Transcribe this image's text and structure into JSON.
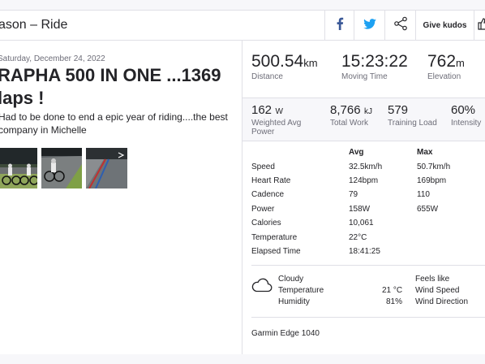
{
  "header": {
    "title": "ason – Ride",
    "kudos_label": "Give kudos"
  },
  "activity": {
    "date": "Saturday, December 24, 2022",
    "title": "RAPHA 500 IN ONE ...1369 laps !",
    "description": "Had to be done to end a epic year of riding....the best company in Michelle"
  },
  "primary_stats": [
    {
      "value": "500.54",
      "unit": "km",
      "label": "Distance"
    },
    {
      "value": "15:23:22",
      "unit": "",
      "label": "Moving Time"
    },
    {
      "value": "762",
      "unit": "m",
      "label": "Elevation"
    }
  ],
  "secondary_stats": [
    {
      "value": "162",
      "unit": "W",
      "label": "Weighted Avg Power"
    },
    {
      "value": "8,766",
      "unit": "kJ",
      "label": "Total Work"
    },
    {
      "value": "579",
      "unit": "",
      "label": "Training Load"
    },
    {
      "value": "60%",
      "unit": "",
      "label": "Intensity"
    }
  ],
  "table": {
    "avg_header": "Avg",
    "max_header": "Max",
    "rows": [
      {
        "label": "Speed",
        "avg": "32.5km/h",
        "max": "50.7km/h"
      },
      {
        "label": "Heart Rate",
        "avg": "124bpm",
        "max": "169bpm"
      },
      {
        "label": "Cadence",
        "avg": "79",
        "max": "110"
      },
      {
        "label": "Power",
        "avg": "158W",
        "max": "655W"
      },
      {
        "label": "Calories",
        "avg": "10,061",
        "max": ""
      },
      {
        "label": "Temperature",
        "avg": "22°C",
        "max": ""
      },
      {
        "label": "Elapsed Time",
        "avg": "18:41:25",
        "max": ""
      }
    ]
  },
  "weather": {
    "condition": "Cloudy",
    "temperature_label": "Temperature",
    "temperature_value": "21 °C",
    "humidity_label": "Humidity",
    "humidity_value": "81%",
    "feels_like_label": "Feels like",
    "wind_speed_label": "Wind Speed",
    "wind_direction_label": "Wind Direction"
  },
  "device": "Garmin Edge 1040",
  "colors": {
    "facebook": "#3b5998",
    "twitter": "#1da1f2",
    "text": "#242428",
    "muted": "#6d6d78",
    "border": "#e0e0e6"
  },
  "icons": [
    "facebook-icon",
    "twitter-icon",
    "share-icon",
    "thumbs-up-icon",
    "cloud-icon"
  ]
}
